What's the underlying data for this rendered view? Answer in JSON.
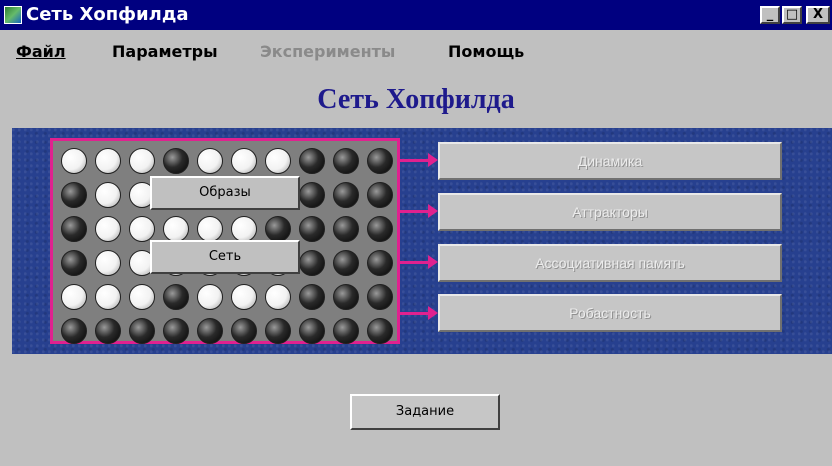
{
  "window": {
    "title": "Сеть Хопфилда",
    "controls": {
      "minimize": "_",
      "maximize": "□",
      "close": "X"
    }
  },
  "menu": [
    {
      "label": "Файл",
      "disabled": false
    },
    {
      "label": "Параметры",
      "disabled": false
    },
    {
      "label": "Эксперименты",
      "disabled": true
    },
    {
      "label": "Помощь",
      "disabled": false
    }
  ],
  "page": {
    "title": "Сеть Хопфилда"
  },
  "network": {
    "grid": [
      [
        1,
        1,
        1,
        0,
        1,
        1,
        1,
        0,
        0,
        0
      ],
      [
        0,
        1,
        1,
        1,
        1,
        1,
        1,
        0,
        0,
        0
      ],
      [
        0,
        1,
        1,
        1,
        1,
        1,
        0,
        0,
        0,
        0
      ],
      [
        0,
        1,
        1,
        1,
        1,
        1,
        1,
        0,
        0,
        0
      ],
      [
        1,
        1,
        1,
        0,
        1,
        1,
        1,
        0,
        0,
        0
      ],
      [
        0,
        0,
        0,
        0,
        0,
        0,
        0,
        0,
        0,
        0
      ]
    ],
    "overlay_buttons": {
      "images": "Образы",
      "network": "Сеть"
    }
  },
  "modes": {
    "dynamics": "Динамика",
    "attractors": "Аттракторы",
    "associative_memory": "Ассоциативная память",
    "robustness": "Робастность"
  },
  "task_button": "Задание",
  "colors": {
    "title_bar": "#000080",
    "page_title": "#1e1a8c",
    "panel": "#27408f",
    "accent_frame": "#e0218f",
    "face": "#c0c0c0"
  }
}
